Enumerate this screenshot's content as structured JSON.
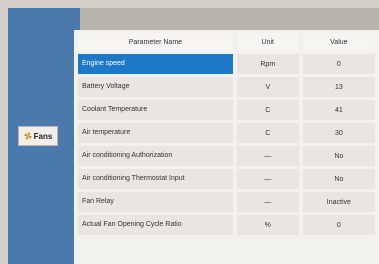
{
  "left_panel": {
    "fans_label": "Fans"
  },
  "table": {
    "headers": {
      "name": "Parameter Name",
      "unit": "Unit",
      "value": "Value"
    },
    "rows": [
      {
        "name": "Engine speed",
        "unit": "Rpm",
        "value": "0"
      },
      {
        "name": "Battery Voltage",
        "unit": "V",
        "value": "13"
      },
      {
        "name": "Coolant Temperature",
        "unit": "C",
        "value": "41"
      },
      {
        "name": "Air temperature",
        "unit": "C",
        "value": "30"
      },
      {
        "name": "Air conditioning Authorization",
        "unit": "—",
        "value": "No"
      },
      {
        "name": "Air conditioning Thermostat Input",
        "unit": "—",
        "value": "No"
      },
      {
        "name": "Fan Relay",
        "unit": "—",
        "value": "Inactive"
      },
      {
        "name": "Actual Fan Opening Cycle Ratio",
        "unit": "%",
        "value": "0"
      }
    ]
  },
  "colors": {
    "panel_blue": "#4c79ab",
    "selection_blue": "#1e78c8"
  }
}
